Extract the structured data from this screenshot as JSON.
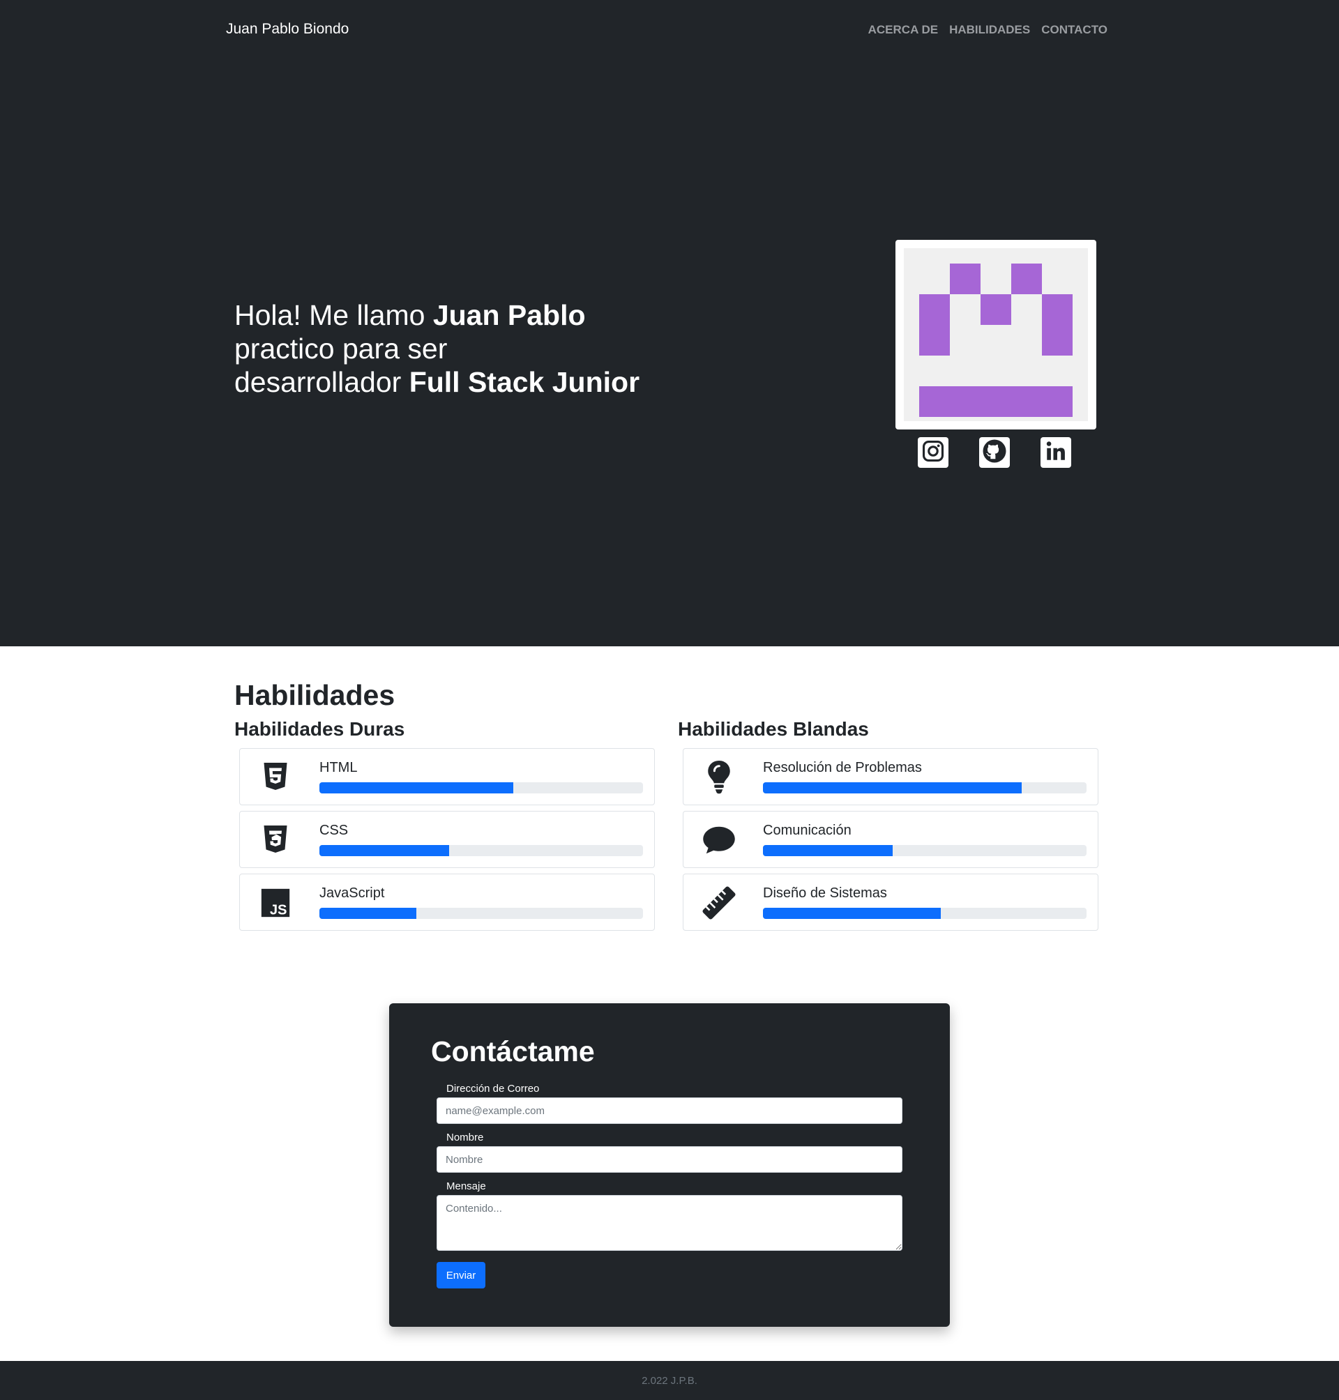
{
  "header": {
    "brand": "Juan Pablo Biondo",
    "nav": [
      "ACERCA DE",
      "HABILIDADES",
      "CONTACTO"
    ]
  },
  "hero": {
    "line1_prefix": "Hola! Me llamo ",
    "line1_name": "Juan Pablo",
    "line2": "practico para ser",
    "line3_prefix": "desarrollador ",
    "line3_role": "Full Stack Junior",
    "avatar_color": "#a666d6",
    "socials": [
      "instagram-icon",
      "github-icon",
      "linkedin-icon"
    ]
  },
  "skills": {
    "title": "Habilidades",
    "hard": {
      "title": "Habilidades Duras",
      "items": [
        {
          "label": "HTML",
          "icon": "html5-icon",
          "percent": 60
        },
        {
          "label": "CSS",
          "icon": "css3-icon",
          "percent": 40
        },
        {
          "label": "JavaScript",
          "icon": "javascript-icon",
          "percent": 30
        }
      ]
    },
    "soft": {
      "title": "Habilidades Blandas",
      "items": [
        {
          "label": "Resolución de Problemas",
          "icon": "lightbulb-icon",
          "percent": 80
        },
        {
          "label": "Comunicación",
          "icon": "chat-bubble-icon",
          "percent": 40
        },
        {
          "label": "Diseño de Sistemas",
          "icon": "ruler-icon",
          "percent": 55
        }
      ]
    },
    "bar_color": "#0d6efd"
  },
  "contact": {
    "title": "Contáctame",
    "email_label": "Dirección de Correo",
    "email_placeholder": "name@example.com",
    "name_label": "Nombre",
    "name_placeholder": "Nombre",
    "message_label": "Mensaje",
    "message_placeholder": "Contenido...",
    "submit_label": "Enviar"
  },
  "footer": {
    "text": "2.022 J.P.B."
  }
}
